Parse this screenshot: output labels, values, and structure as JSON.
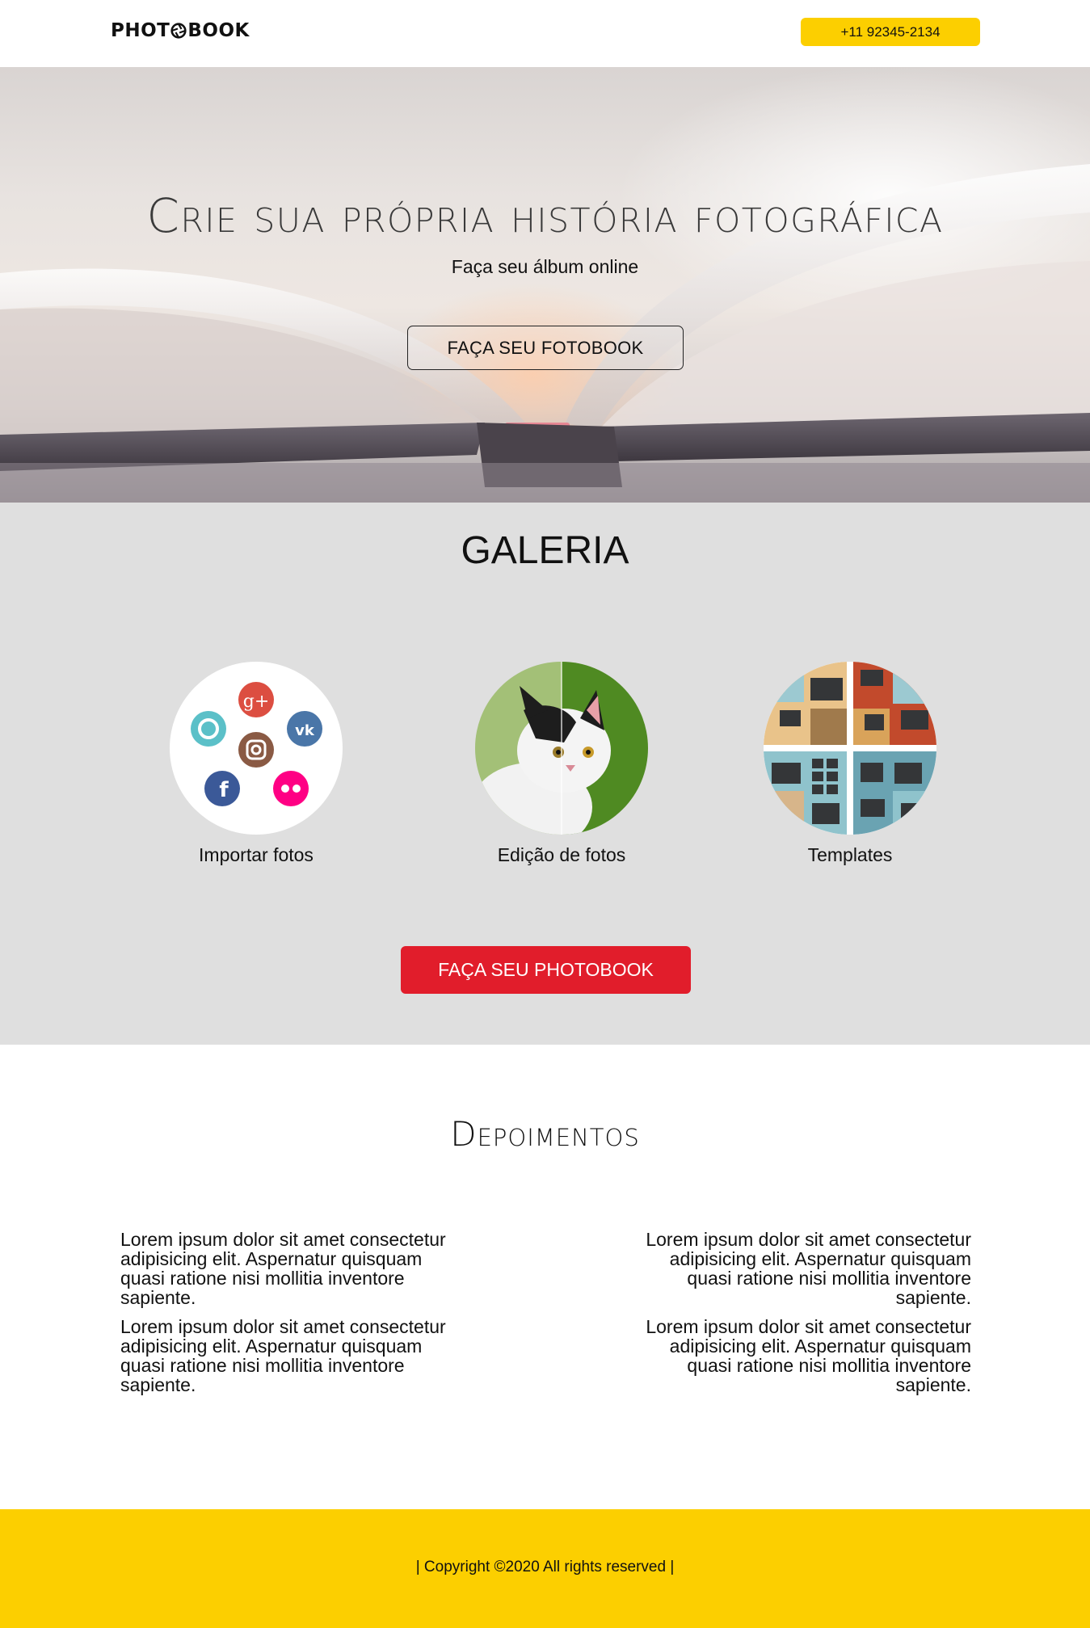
{
  "header": {
    "logo_left": "PHOT",
    "logo_right": "BOOK",
    "phone": "+11 92345-2134"
  },
  "hero": {
    "title": "Crie sua própria história fotográfica",
    "subtitle": "Faça seu álbum online",
    "button_label": "FAÇA SEU FOTOBOOK"
  },
  "gallery": {
    "title": "GALERIA",
    "items": [
      {
        "label": "Importar fotos",
        "icon": "social-import-icon"
      },
      {
        "label": "Edição de fotos",
        "icon": "cat-photo-edit-icon"
      },
      {
        "label": "Templates",
        "icon": "templates-grid-icon"
      }
    ],
    "button_label": "FAÇA SEU PHOTOBOOK"
  },
  "testimonials": {
    "title": "Depoimentos",
    "left": [
      "Lorem ipsum dolor sit amet consectetur adipisicing elit. Aspernatur quisquam quasi ratione nisi mollitia inventore sapiente.",
      "Lorem ipsum dolor sit amet consectetur adipisicing elit. Aspernatur quisquam quasi ratione nisi mollitia inventore sapiente."
    ],
    "right": [
      "Lorem ipsum dolor sit amet consectetur adipisicing elit. Aspernatur quisquam quasi ratione nisi mollitia inventore sapiente.",
      "Lorem ipsum dolor sit amet consectetur adipisicing elit. Aspernatur quisquam quasi ratione nisi mollitia inventore sapiente."
    ]
  },
  "footer": {
    "copyright": "| Copyright ©2020 All rights reserved |"
  },
  "colors": {
    "accent_yellow": "#fccf00",
    "cta_red": "#e11d2b",
    "gallery_bg": "#dfdfdf"
  }
}
